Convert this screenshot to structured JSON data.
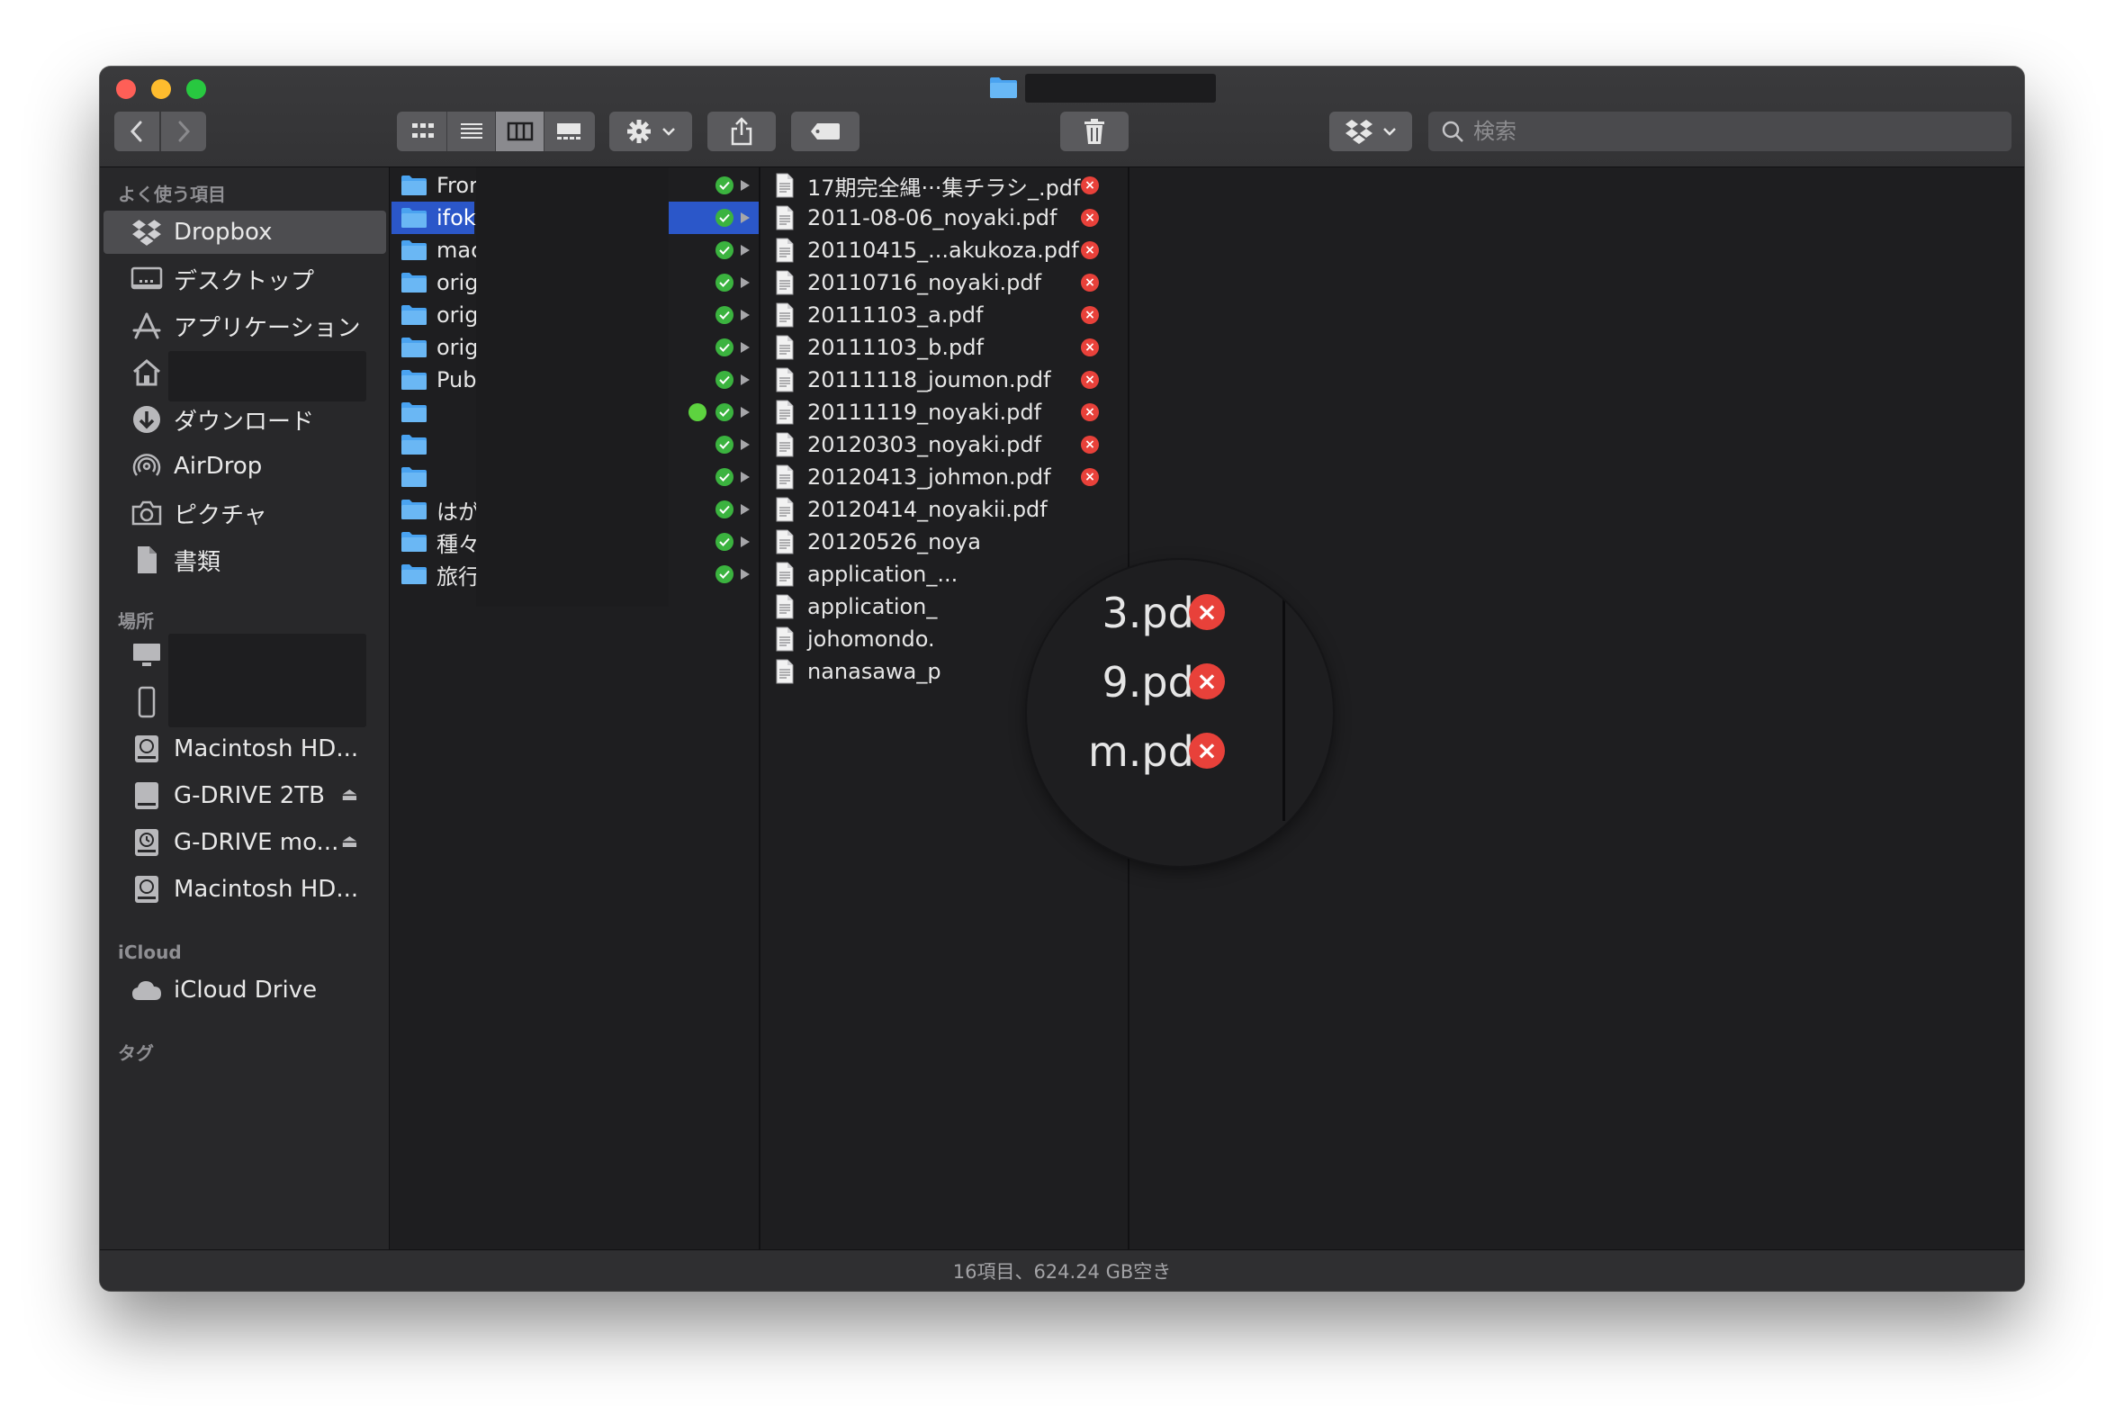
{
  "toolbar": {
    "search_placeholder": "検索"
  },
  "sidebar": {
    "favorites_title": "よく使う項目",
    "favorites": [
      {
        "label": "Dropbox",
        "icon": "dropbox-icon"
      },
      {
        "label": "デスクトップ",
        "icon": "desktop-icon"
      },
      {
        "label": "アプリケーション",
        "icon": "applications-icon"
      },
      {
        "label": "",
        "icon": "home-icon"
      },
      {
        "label": "ダウンロード",
        "icon": "downloads-icon"
      },
      {
        "label": "AirDrop",
        "icon": "airdrop-icon"
      },
      {
        "label": "ピクチャ",
        "icon": "camera-icon"
      },
      {
        "label": "書類",
        "icon": "documents-icon"
      }
    ],
    "locations_title": "場所",
    "locations": [
      {
        "label": "Macintosh HD...",
        "icon": "hard-drive-icon"
      },
      {
        "label": "G-DRIVE 2TB",
        "icon": "external-drive-icon",
        "eject": true
      },
      {
        "label": "G-DRIVE mo...",
        "icon": "time-machine-drive-icon",
        "eject": true
      },
      {
        "label": "Macintosh HD...",
        "icon": "hard-drive-icon"
      }
    ],
    "icloud_title": "iCloud",
    "icloud": [
      {
        "label": "iCloud Drive",
        "icon": "cloud-icon"
      }
    ],
    "tags_title": "タグ",
    "eject_glyph": "⏏"
  },
  "column1": {
    "folders": [
      {
        "name": "Fror",
        "status": "synced"
      },
      {
        "name": "ifok",
        "status": "synced",
        "selected": true
      },
      {
        "name": "mac",
        "status": "synced"
      },
      {
        "name": "orig",
        "status": "synced"
      },
      {
        "name": "orig",
        "status": "synced"
      },
      {
        "name": "orig",
        "status": "synced"
      },
      {
        "name": "Pub",
        "status": "synced"
      },
      {
        "name": "",
        "status": "synced",
        "extra_dot": true
      },
      {
        "name": "",
        "status": "synced"
      },
      {
        "name": "",
        "status": "synced"
      },
      {
        "name": "はが",
        "status": "synced"
      },
      {
        "name": "種々",
        "status": "synced"
      },
      {
        "name": "旅行",
        "status": "synced"
      }
    ]
  },
  "column2": {
    "files": [
      "17期完全縄···集チラシ_.pdf",
      "2011-08-06_noyaki.pdf",
      "20110415_...akukoza.pdf",
      "20110716_noyaki.pdf",
      "20111103_a.pdf",
      "20111103_b.pdf",
      "20111118_joumon.pdf",
      "20111119_noyaki.pdf",
      "20120303_noyaki.pdf",
      "20120413_johmon.pdf",
      "20120414_noyakii.pdf",
      "20120526_noya",
      "application_...",
      "application_",
      "johomondo.",
      "nanasawa_p"
    ],
    "error_glyph": "×"
  },
  "magnifier": {
    "lines": [
      "3.pdf",
      "9.pdf",
      "m.pdf"
    ]
  },
  "statusbar": {
    "text": "16項目、624.24 GB空き"
  },
  "colors": {
    "selection": "#2b57c9",
    "synced": "#3bb33f",
    "error": "#e8413a",
    "folder": "#4aa3f0"
  }
}
